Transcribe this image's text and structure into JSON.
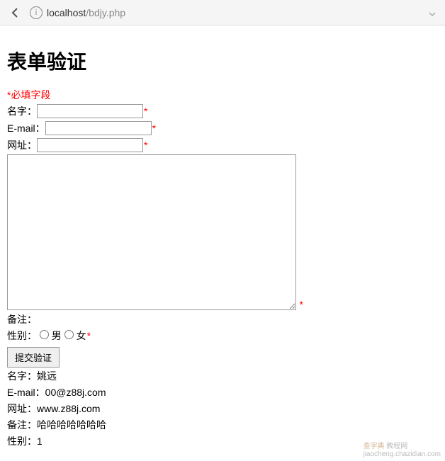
{
  "browser": {
    "url_host": "localhost",
    "url_path": "/bdjy.php"
  },
  "page": {
    "title": "表单验证",
    "required_note": "*必填字段"
  },
  "form": {
    "name_label": "名字：",
    "name_value": "",
    "email_label": "E-mail：",
    "email_value": "",
    "url_label": "网址：",
    "url_value": "",
    "comment_label": "备注：",
    "comment_value": "",
    "gender_label": "性别：",
    "gender_male": "男",
    "gender_female": "女",
    "submit_label": "提交验证",
    "asterisk": "*"
  },
  "output": {
    "name_label": "名字：",
    "name_value": "姚远",
    "email_label": "E-mail：",
    "email_value": "00@z88j.com",
    "url_label": "网址：",
    "url_value": "www.z88j.com",
    "comment_label": "备注：",
    "comment_value": "哈哈哈哈哈哈哈",
    "gender_label": "性别：",
    "gender_value": "1"
  },
  "watermark": {
    "brand": "查字典",
    "text": "教程网",
    "url": "jiaocheng.chazidian.com"
  }
}
